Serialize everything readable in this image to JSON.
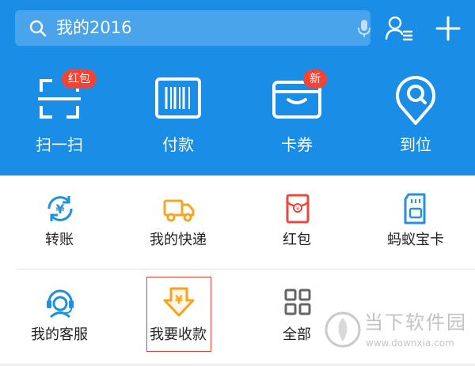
{
  "search": {
    "text": "我的2016"
  },
  "quick_actions": [
    {
      "label": "扫一扫",
      "icon": "scan-icon",
      "badge": "红包"
    },
    {
      "label": "付款",
      "icon": "barcode-icon"
    },
    {
      "label": "卡券",
      "icon": "card-icon",
      "badge": "新"
    },
    {
      "label": "到位",
      "icon": "location-pin-icon"
    }
  ],
  "grid_row1": [
    {
      "label": "转账",
      "icon": "transfer-icon"
    },
    {
      "label": "我的快递",
      "icon": "delivery-truck-icon"
    },
    {
      "label": "红包",
      "icon": "red-envelope-icon"
    },
    {
      "label": "蚂蚁宝卡",
      "icon": "sim-card-icon"
    }
  ],
  "grid_row2": [
    {
      "label": "我的客服",
      "icon": "customer-service-icon"
    },
    {
      "label": "我要收款",
      "icon": "receive-money-icon"
    },
    {
      "label": "全部",
      "icon": "all-apps-icon"
    }
  ],
  "watermark": {
    "title": "当下软件园",
    "url": "www.downxia.com"
  },
  "colors": {
    "header_blue": "#1a8ee6",
    "search_bg": "#4aa4ec",
    "badge_red": "#f04536",
    "transfer_blue": "#1b91e0",
    "truck_orange": "#f5a623",
    "envelope_red": "#e8493e",
    "sim_blue": "#2a8fdc",
    "money_orange": "#f7a21b",
    "grid_gray": "#666666"
  }
}
